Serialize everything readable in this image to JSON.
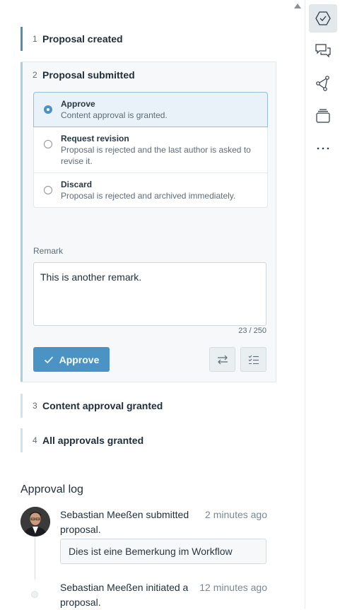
{
  "steps": [
    {
      "num": "1",
      "title": "Proposal created"
    },
    {
      "num": "2",
      "title": "Proposal submitted"
    },
    {
      "num": "3",
      "title": "Content approval granted"
    },
    {
      "num": "4",
      "title": "All approvals granted"
    }
  ],
  "options": [
    {
      "title": "Approve",
      "desc": "Content approval is granted.",
      "selected": true
    },
    {
      "title": "Request revision",
      "desc": "Proposal is rejected and the last author is asked to revise it.",
      "selected": false
    },
    {
      "title": "Discard",
      "desc": "Proposal is rejected and archived immediately.",
      "selected": false
    }
  ],
  "remark": {
    "label": "Remark",
    "value": "This is another remark.",
    "counter": "23 / 250"
  },
  "actions": {
    "approve_label": "Approve"
  },
  "log": {
    "title": "Approval log",
    "entries": [
      {
        "text": "Sebastian Meeßen submitted proposal.",
        "time": "2 minutes ago",
        "remark": "Dies ist eine Bemerkung im Workflow"
      },
      {
        "text": "Sebastian Meeßen initiated a proposal.",
        "time": "12 minutes ago"
      }
    ]
  },
  "rail": {
    "items": [
      "workflow-icon",
      "comments-icon",
      "share-graph-icon",
      "layers-icon",
      "more-icon"
    ]
  },
  "colors": {
    "accent": "#4a93c4",
    "active_bar": "#4d8fb8"
  }
}
